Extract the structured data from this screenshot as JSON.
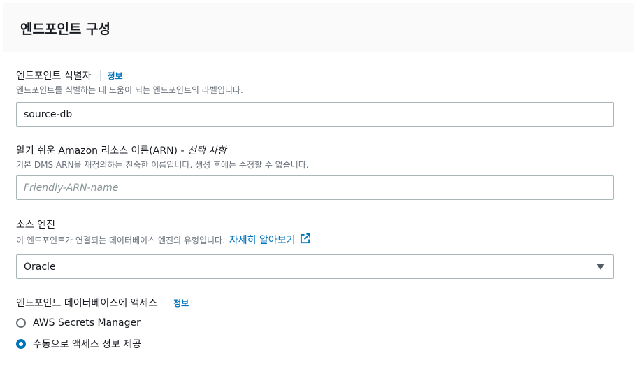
{
  "panel": {
    "title": "엔드포인트 구성"
  },
  "endpoint_id": {
    "label": "엔드포인트 식별자",
    "info": "정보",
    "description": "엔드포인트를 식별하는 데 도움이 되는 엔드포인트의 라벨입니다.",
    "value": "source-db"
  },
  "arn": {
    "label": "알기 쉬운 Amazon 리소스 이름(ARN) - ",
    "optional": "선택 사항",
    "description": "기본 DMS ARN을 재정의하는 친숙한 이름입니다. 생성 후에는 수정할 수 없습니다.",
    "placeholder": "Friendly-ARN-name"
  },
  "source_engine": {
    "label": "소스 엔진",
    "description": "이 엔드포인트가 연결되는 데이터베이스 엔진의 유형입니다.",
    "learn_more": "자세히 알아보기",
    "selected": "Oracle"
  },
  "access": {
    "label": "엔드포인트 데이터베이스에 액세스",
    "info": "정보",
    "options": [
      {
        "label": "AWS Secrets Manager",
        "checked": false
      },
      {
        "label": "수동으로 액세스 정보 제공",
        "checked": true
      }
    ]
  },
  "colors": {
    "link": "#0073bb",
    "radio_selected": "#0073bb"
  }
}
